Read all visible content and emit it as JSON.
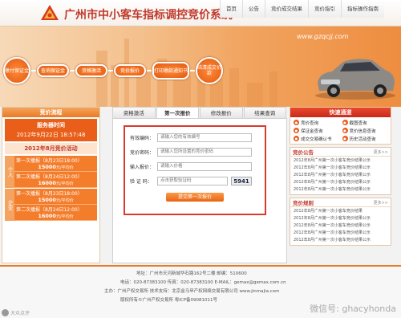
{
  "header": {
    "title": "广州市中小客车指标调控竞价系统",
    "nav": [
      "首页",
      "公告",
      "竞价成交结果",
      "竞价指引",
      "指标操作指南"
    ]
  },
  "banner": {
    "url": "www.gzqcjj.com",
    "steps": [
      "缴付保证金",
      "查询保证金",
      "资格激活",
      "竞价报价",
      "打印缴款通知书",
      "结清成交价款"
    ]
  },
  "left": {
    "title": "竞价流程",
    "server_time_label": "服务器时间",
    "server_time": "2012年9月22日 18:57:48",
    "activity_title": "2012年8月竞价活动",
    "groups": [
      {
        "tab": "个人",
        "events": [
          {
            "line": "第一次播报（8月23日18:00）",
            "quota": "15000",
            "unit": "元/平均价"
          },
          {
            "line": "第二次播报（8月24日12:00）",
            "quota": "16000",
            "unit": "元/平均价"
          }
        ]
      },
      {
        "tab": "企业",
        "events": [
          {
            "line": "第一次播报（8月23日18:00）",
            "quota": "15000",
            "unit": "元/平均价"
          },
          {
            "line": "第二次播报（8月24日12:00）",
            "quota": "16000",
            "unit": "元/平均价"
          }
        ]
      }
    ]
  },
  "center": {
    "tabs": [
      "资格激活",
      "第一次报价",
      "修改报价",
      "结果查询"
    ],
    "active_tab": 1,
    "form": {
      "fields": [
        {
          "label": "有效编码：",
          "placeholder": "请输入您的有效编号"
        },
        {
          "label": "竞价密码：",
          "placeholder": "请输入您所设置的竞价密码"
        },
        {
          "label": "输入报价：",
          "placeholder": "请输入价格"
        }
      ],
      "captcha_label": "验 证 码：",
      "captcha_placeholder": "点击获取验证码",
      "captcha_code": "5941",
      "submit": "提交第一次报价"
    }
  },
  "right": {
    "quick_title": "快速通道",
    "quick_links": [
      "竞价查询",
      "截图查询",
      "保证金查询",
      "竞价信息查询",
      "成交交易确认书",
      "历史活动查询"
    ],
    "notice_title": "竞价公告",
    "notice_more": "更多>>",
    "notices": [
      "2012年8月广州第一次小客车竞价结果公示",
      "2012年8月广州第一次小客车竞价结果公示",
      "2012年8月广州第一次小客车竞价结果公示",
      "2012年8月广州第一次小客车竞价结果公示",
      "2012年8月广州第一次小客车竞价结果公示"
    ],
    "rules_title": "竞价规则",
    "rules_more": "更多>>",
    "rules": [
      "2012年8月广州第一次小客车竞价结果",
      "2012年8月广州第一次小客车竞价结果公示",
      "2012年8月广州第一次小客车竞价结果公示",
      "2012年8月广州第一次小客车竞价结果公示",
      "2012年8月广州第一次小客车竞价结果公示"
    ]
  },
  "footer": {
    "address": "地址：广州市天河新城华石路162号二楼        邮编：510600",
    "phone": "电话：020-87383100    传真：020-87383100    E-MAIL：gemax@gemax.com.cn",
    "host": "主办：广州产权交易所        技术支持：北京金马甲产权网络交易有限公司  www.jinmajia.com",
    "copyright": "版权所有©广州产权交易所     粤ICP备09081011号",
    "watermark": "微信号: ghacyhonda",
    "watermark2": "大众点评"
  },
  "colors": {
    "brand_orange": "#e87a26",
    "brand_red": "#c0392b",
    "form_border": "#d93a2b"
  }
}
